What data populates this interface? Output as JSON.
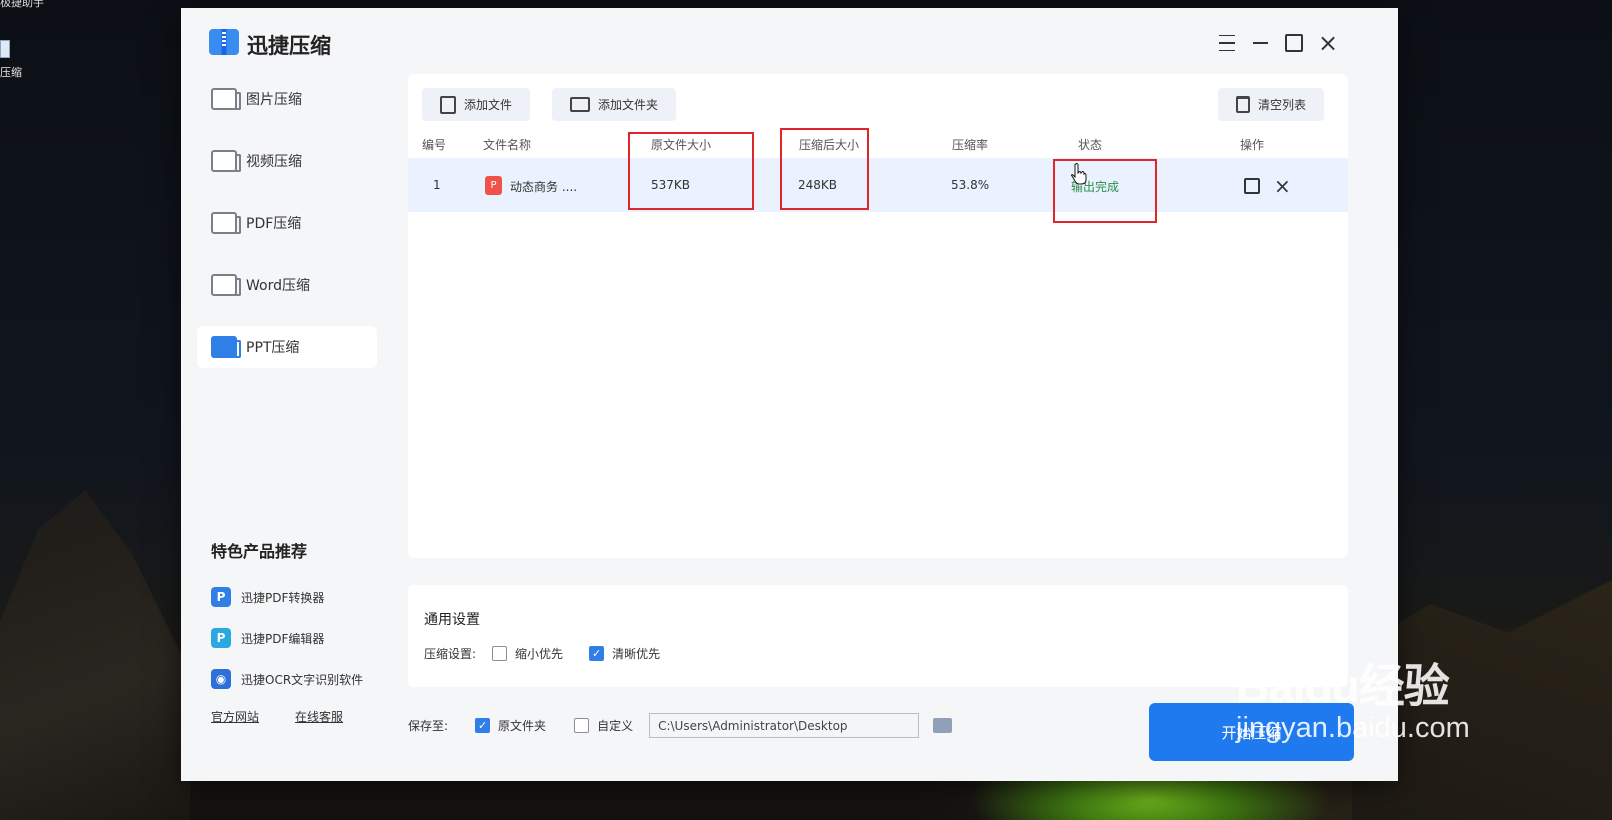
{
  "desktop": {
    "top_label": "极捷助手",
    "icon_label": "压缩"
  },
  "app": {
    "title": "迅捷压缩",
    "window_controls": [
      "menu-icon",
      "minimize-icon",
      "maximize-icon",
      "close-icon"
    ]
  },
  "sidebar": {
    "items": [
      {
        "label": "图片压缩",
        "icon": "image-icon",
        "active": false
      },
      {
        "label": "视频压缩",
        "icon": "video-icon",
        "active": false
      },
      {
        "label": "PDF压缩",
        "icon": "pdf-icon",
        "active": false
      },
      {
        "label": "Word压缩",
        "icon": "word-icon",
        "active": false
      },
      {
        "label": "PPT压缩",
        "icon": "ppt-icon",
        "active": true
      }
    ],
    "promo_title": "特色产品推荐",
    "promo_items": [
      {
        "label": "迅捷PDF转换器",
        "glyph": "P",
        "color": "#2f7fe6"
      },
      {
        "label": "迅捷PDF编辑器",
        "glyph": "P",
        "color": "#2aa8e0"
      },
      {
        "label": "迅捷OCR文字识别软件",
        "glyph": "◉",
        "color": "#2f6fd8"
      }
    ],
    "footer_links": [
      "官方网站",
      "在线客服"
    ]
  },
  "toolbar": {
    "add_file": "添加文件",
    "add_folder": "添加文件夹",
    "clear_list": "清空列表"
  },
  "table": {
    "headers": [
      "编号",
      "文件名称",
      "原文件大小",
      "压缩后大小",
      "压缩率",
      "状态",
      "操作"
    ],
    "rows": [
      {
        "index": "1",
        "name": "动态商务 ....",
        "original_size": "537KB",
        "compressed_size": "248KB",
        "ratio": "53.8%",
        "status": "输出完成"
      }
    ]
  },
  "settings": {
    "title": "通用设置",
    "label": "压缩设置:",
    "options": [
      {
        "label": "缩小优先",
        "checked": false
      },
      {
        "label": "清晰优先",
        "checked": true
      }
    ]
  },
  "save": {
    "label": "保存至:",
    "options": [
      {
        "label": "原文件夹",
        "checked": true
      },
      {
        "label": "自定义",
        "checked": false
      }
    ],
    "path": "C:\\Users\\Administrator\\Desktop"
  },
  "start_button": "开始压缩",
  "watermark": {
    "main": "Baidu经验",
    "sub": "jingyan.baidu.com"
  },
  "colors": {
    "accent": "#1f7af0",
    "highlight_box": "#e0262b",
    "status_done": "#2c8d4b",
    "row_selected": "#e9f2fe"
  }
}
